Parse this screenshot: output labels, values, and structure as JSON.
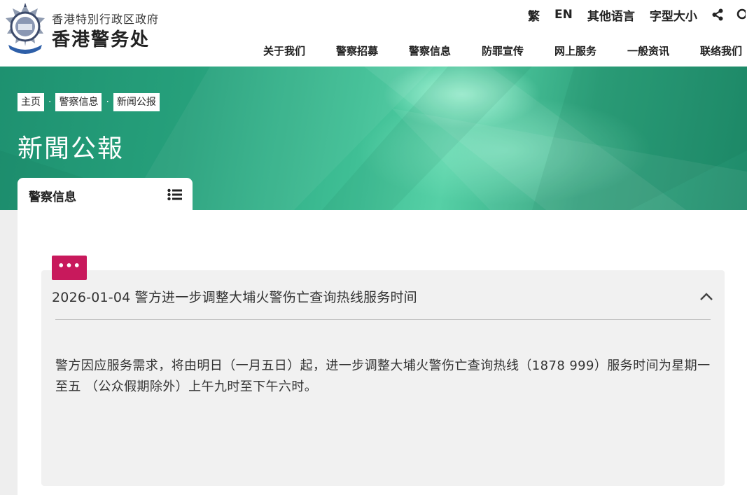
{
  "header": {
    "gov_name": "香港特別行政区政府",
    "dept_name": "香港警务处"
  },
  "utility": {
    "traditional": "繁",
    "english": "EN",
    "other_languages": "其他语言",
    "font_size": "字型大小",
    "share_icon": "share-icon",
    "search_icon": "search-icon"
  },
  "nav": {
    "items": [
      "关于我们",
      "警察招募",
      "警察信息",
      "防罪宣传",
      "网上服务",
      "一般资讯",
      "联络我们"
    ]
  },
  "breadcrumb": [
    "主页",
    "警察信息",
    "新闻公报"
  ],
  "page_title": "新聞公報",
  "side_tab": {
    "label": "警察信息",
    "icon": "list-icon"
  },
  "more_button": {
    "label": "•••",
    "color": "#c8195c"
  },
  "article": {
    "title": "2026-01-04 警方进一步调整大埔火警伤亡查询热线服务时间",
    "body": "警方因应服务需求，将由明日（一月五日）起，进一步调整大埔火警伤亡查询热线（1878 999）服务时间为星期一至五 （公众假期除外）上午九时至下午六时。",
    "toggle_icon": "chevron-up-icon"
  },
  "colors": {
    "banner_green": "#26a07b",
    "accent_magenta": "#c8195c",
    "card_bg": "#f1f1f1"
  }
}
